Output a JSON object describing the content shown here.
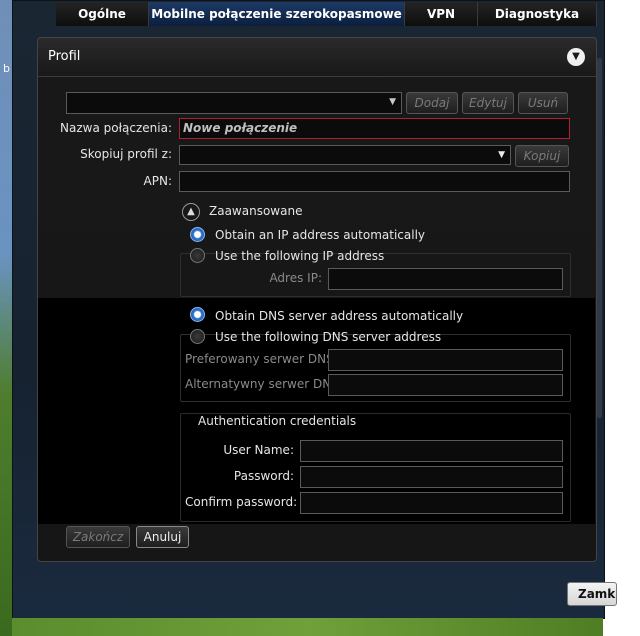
{
  "desktop": {
    "edge_glyph": "b"
  },
  "tabs": [
    {
      "label": "Ogólne",
      "active": false
    },
    {
      "label": "Mobilne połączenie szerokopasmowe",
      "active": true
    },
    {
      "label": "VPN",
      "active": false
    },
    {
      "label": "Diagnostyka",
      "active": false
    }
  ],
  "profile": {
    "title": "Profil",
    "collapse_icon": "chevron-down-icon",
    "profile_select_value": "",
    "buttons": {
      "add": "Dodaj",
      "edit": "Edytuj",
      "delete": "Usuń"
    },
    "connection_name_label": "Nazwa połączenia:",
    "connection_name_value": "Nowe połączenie",
    "copy_profile_label": "Skopiuj profil z:",
    "copy_profile_value": "",
    "copy_button": "Kopiuj",
    "apn_label": "APN:",
    "apn_value": "",
    "advanced_label": "Zaawansowane",
    "ip": {
      "auto_label": "Obtain an IP address automatically",
      "manual_label": "Use the following IP address",
      "selected": "auto",
      "address_label": "Adres IP:",
      "address_value": ""
    },
    "dns": {
      "auto_label": "Obtain DNS server address automatically",
      "manual_label": "Use the following DNS server address",
      "selected": "auto",
      "preferred_label": "Preferowany serwer DNS:",
      "preferred_value": "",
      "alternate_label": "Alternatywny serwer DNS:",
      "alternate_value": ""
    },
    "auth": {
      "title": "Authentication credentials",
      "user_label": "User Name:",
      "user_value": "",
      "password_label": "Password:",
      "password_value": "",
      "confirm_label": "Confirm password:",
      "confirm_value": ""
    },
    "finish_button": "Zakończ",
    "cancel_button": "Anuluj"
  },
  "close_button": "Zamk",
  "colors": {
    "accent": "#1d5eb8",
    "error_border": "#b02030",
    "tab_active": "#1d3a66"
  }
}
